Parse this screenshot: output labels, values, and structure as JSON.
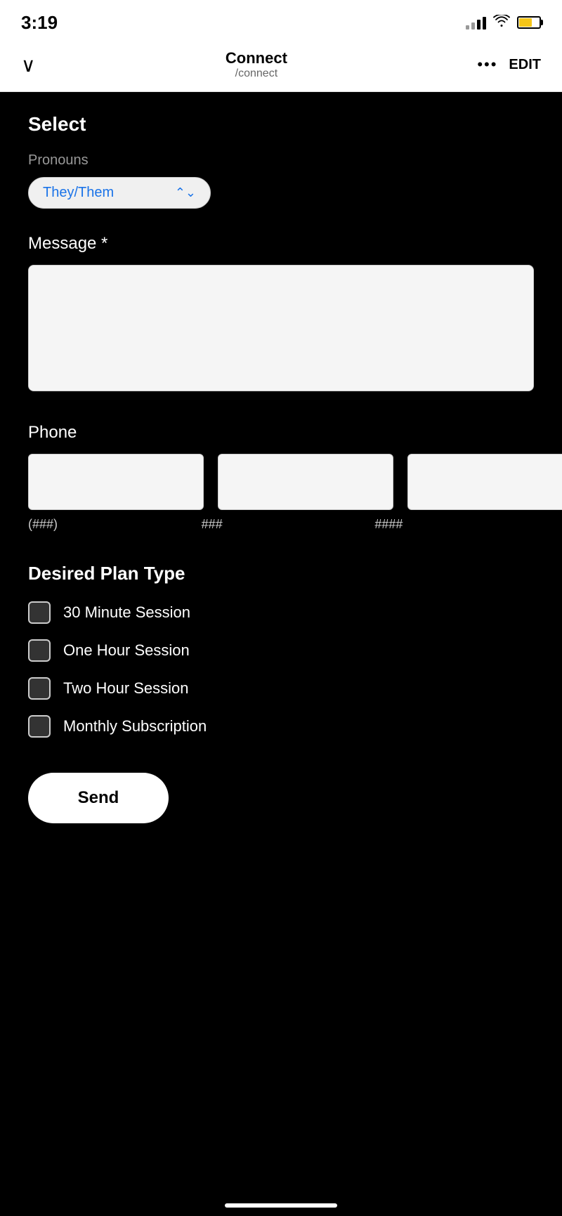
{
  "statusBar": {
    "time": "3:19",
    "signalBars": [
      4,
      7,
      10,
      13
    ],
    "batteryPercent": 65
  },
  "navBar": {
    "chevronSymbol": "∨",
    "title": "Connect",
    "subtitle": "/connect",
    "dotsLabel": "•••",
    "editLabel": "EDIT"
  },
  "form": {
    "selectLabel": "Select",
    "pronounsLabel": "Pronouns",
    "pronounsValue": "They/Them",
    "messageLabel": "Message *",
    "messagePlaceholder": "",
    "phoneLabel": "Phone",
    "phoneFormat1": "(###)",
    "phoneFormat2": "###",
    "phoneFormat3": "####",
    "planTypeLabel": "Desired Plan Type",
    "planOptions": [
      {
        "id": "30min",
        "label": "30 Minute Session",
        "checked": false
      },
      {
        "id": "1hour",
        "label": "One Hour Session",
        "checked": false
      },
      {
        "id": "2hour",
        "label": "Two Hour Session",
        "checked": false
      },
      {
        "id": "monthly",
        "label": "Monthly Subscription",
        "checked": false
      }
    ],
    "sendLabel": "Send"
  }
}
